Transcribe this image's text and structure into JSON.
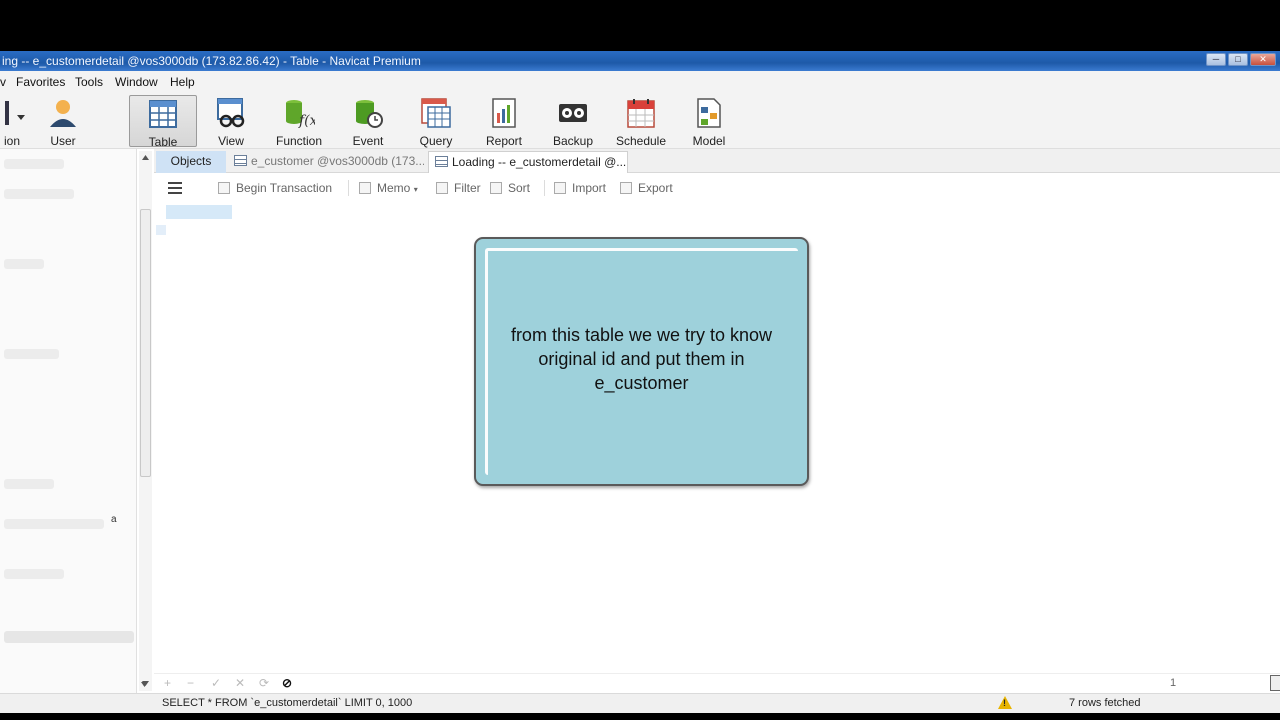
{
  "window": {
    "title": "ing -- e_customerdetail @vos3000db (173.82.86.42) - Table - Navicat Premium",
    "buttons": [
      "─",
      "□",
      "✕"
    ]
  },
  "menu": {
    "items": [
      "v",
      "Favorites",
      "Tools",
      "Window",
      "Help"
    ]
  },
  "toolbar": {
    "left_labels": [
      "ion",
      "User"
    ],
    "tools": [
      {
        "label": "Table",
        "icon": "table-icon",
        "active": true
      },
      {
        "label": "View",
        "icon": "view-icon"
      },
      {
        "label": "Function",
        "icon": "function-icon"
      },
      {
        "label": "Event",
        "icon": "event-icon"
      },
      {
        "label": "Query",
        "icon": "query-icon"
      },
      {
        "label": "Report",
        "icon": "report-icon"
      },
      {
        "label": "Backup",
        "icon": "backup-icon"
      },
      {
        "label": "Schedule",
        "icon": "schedule-icon"
      },
      {
        "label": "Model",
        "icon": "model-icon"
      }
    ]
  },
  "tabs": {
    "objects": "Objects",
    "customer": "e_customer @vos3000db (173....",
    "loading": "Loading -- e_customerdetail @..."
  },
  "subtoolbar": {
    "begin_transaction": "Begin Transaction",
    "memo": "Memo",
    "filter": "Filter",
    "sort": "Sort",
    "import": "Import",
    "export": "Export"
  },
  "sidebar": {
    "stray_text": "a"
  },
  "note": {
    "text": "from this table we we try to know original id and put them in e_customer",
    "color": "#9ed1db"
  },
  "navbar": {
    "add": "+",
    "remove": "−",
    "apply": "✓",
    "discard": "✕",
    "refresh": "⟳",
    "stop": "⊘",
    "page": "1"
  },
  "status": {
    "sql": "SELECT * FROM `e_customerdetail` LIMIT 0, 1000",
    "rows_fetched": "7 rows fetched"
  },
  "colors": {
    "titlebar": "#1e5aa8",
    "accent_tab": "#cfe2f5",
    "warning": "#e8b400"
  }
}
